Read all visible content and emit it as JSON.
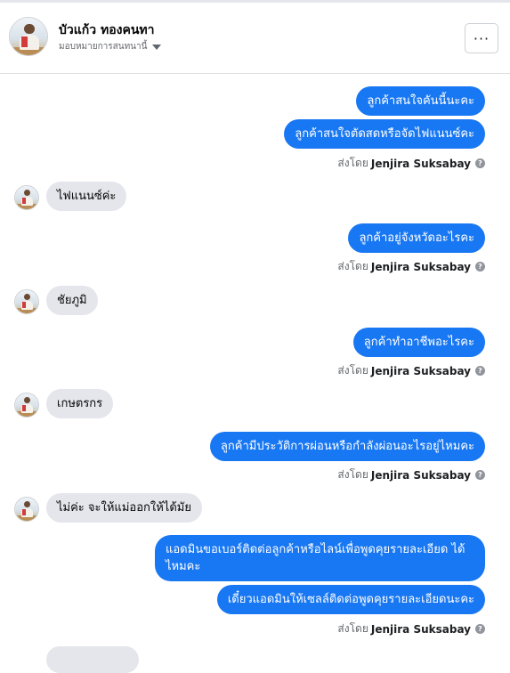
{
  "header": {
    "contact_name": "บัวแก้ว ทองคนทา",
    "assign_label": "มอบหมายการสนทนานี้",
    "more_label": "···"
  },
  "sender_prefix": "ส่งโดย",
  "sender_name": "Jenjira Suksabay",
  "help_glyph": "?",
  "messages": [
    {
      "dir": "out",
      "text": "ลูกค้าสนใจคันนี้นะคะ"
    },
    {
      "dir": "out",
      "text": "ลูกค้าสนใจตัดสดหรือจัดไฟแนนซ์คะ"
    },
    {
      "dir": "in",
      "text": "ไฟแนนซ์ค่ะ"
    },
    {
      "dir": "out",
      "text": "ลูกค้าอยู่จังหวัดอะไรคะ"
    },
    {
      "dir": "in",
      "text": "ชัยภูมิ"
    },
    {
      "dir": "out",
      "text": "ลูกค้าทำอาชีพอะไรคะ"
    },
    {
      "dir": "in",
      "text": "เกษตรกร"
    },
    {
      "dir": "out",
      "text": "ลูกค้ามีประวัติการผ่อนหรือกำลังผ่อนอะไรอยู่ไหมคะ"
    },
    {
      "dir": "in",
      "text": "ไม่ค่ะ จะให้แม่ออกให้ได้มัย"
    },
    {
      "dir": "out",
      "text": "แอดมินขอเบอร์ติดต่อลูกค้าหรือไลน์เพื่อพูดคุยรายละเอียด ได้ไหมคะ"
    },
    {
      "dir": "out",
      "text": "เดี๋ยวแอดมินให้เซลล์ติดต่อพูดคุยรายละเอียดนะคะ"
    }
  ],
  "colors": {
    "outgoing_bubble": "#1877f2",
    "incoming_bubble": "#e4e6eb",
    "meta_text": "#65676b"
  }
}
